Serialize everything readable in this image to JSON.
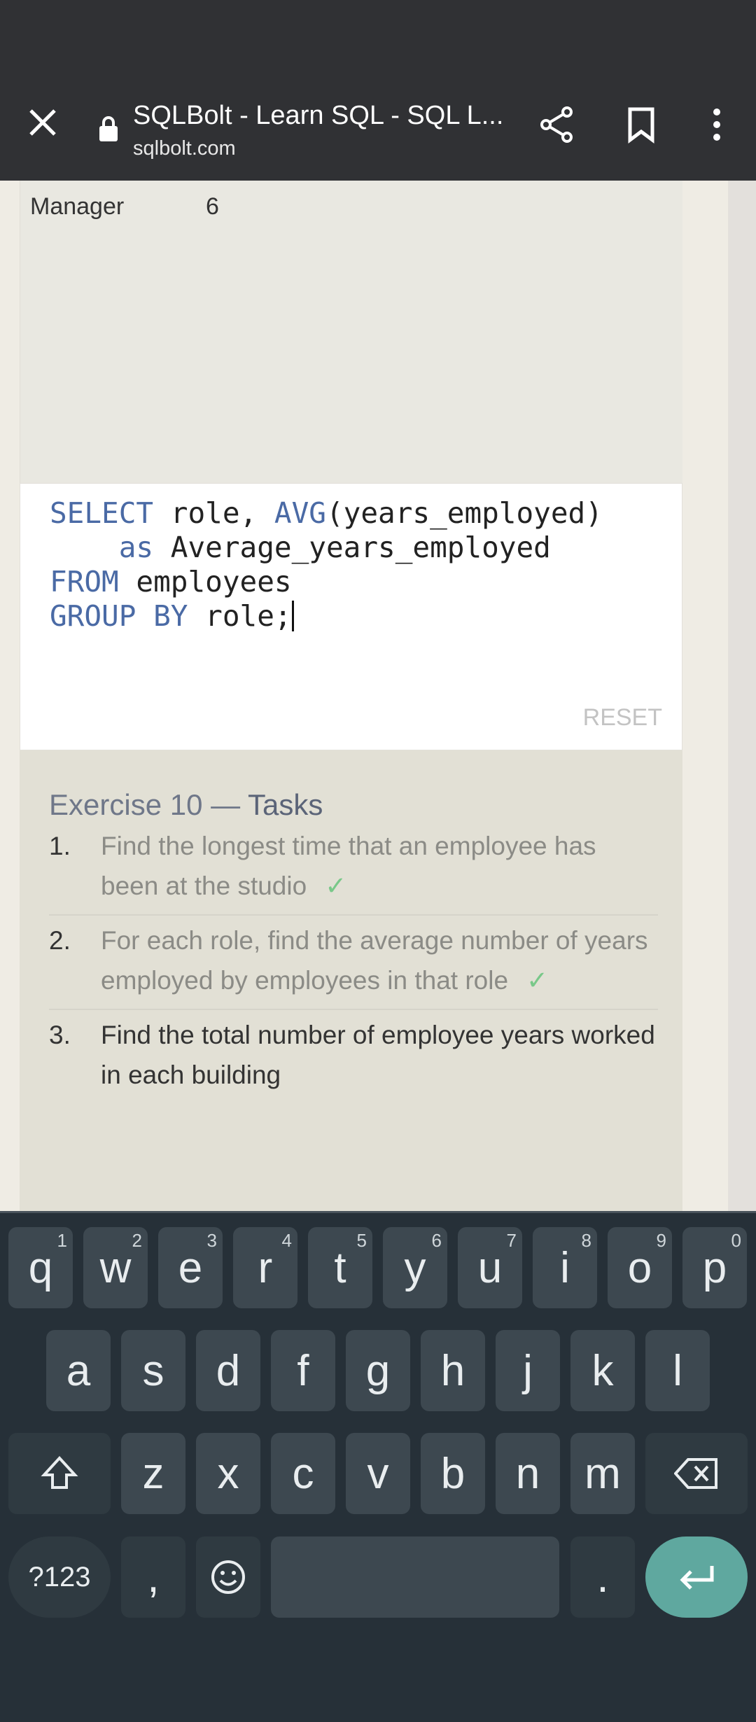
{
  "browser": {
    "title": "SQLBolt - Learn SQL - SQL L...",
    "url": "sqlbolt.com",
    "icons": [
      "close-icon",
      "lock-icon",
      "share-icon",
      "bookmark-icon",
      "more-vert-icon"
    ]
  },
  "results": {
    "row": {
      "role": "Manager",
      "value": "6"
    }
  },
  "editor": {
    "lines": [
      [
        {
          "kw": "SELECT"
        },
        {
          "t": " role, "
        },
        {
          "kw": "AVG"
        },
        {
          "t": "(years_employed)"
        }
      ],
      [
        {
          "t": "    "
        },
        {
          "kw": "as"
        },
        {
          "t": " Average_years_employed"
        }
      ],
      [
        {
          "kw": "FROM"
        },
        {
          "t": " employees"
        }
      ],
      [
        {
          "kw": "GROUP BY"
        },
        {
          "t": " role;"
        }
      ]
    ],
    "reset_label": "RESET",
    "keyword_color": "#4a6aa5"
  },
  "tasks": {
    "heading_a": "Exercise 10 — ",
    "heading_b": "Tasks",
    "check": "✓",
    "check_color": "#79c889",
    "items": [
      {
        "num": "1.",
        "text": "Find the longest time that an employee has been at the studio",
        "done": true
      },
      {
        "num": "2.",
        "text": "For each role, find the average number of years employed by employees in that role",
        "done": true
      },
      {
        "num": "3.",
        "text": "Find the total number of employee years worked in each building",
        "done": false
      }
    ]
  },
  "keyboard": {
    "row1": [
      [
        "q",
        "1"
      ],
      [
        "w",
        "2"
      ],
      [
        "e",
        "3"
      ],
      [
        "r",
        "4"
      ],
      [
        "t",
        "5"
      ],
      [
        "y",
        "6"
      ],
      [
        "u",
        "7"
      ],
      [
        "i",
        "8"
      ],
      [
        "o",
        "9"
      ],
      [
        "p",
        "0"
      ]
    ],
    "row2": [
      "a",
      "s",
      "d",
      "f",
      "g",
      "h",
      "j",
      "k",
      "l"
    ],
    "row3": [
      "z",
      "x",
      "c",
      "v",
      "b",
      "n",
      "m"
    ],
    "symbols_label": "?123",
    "comma": ",",
    "period": ".",
    "icons": [
      "shift-icon",
      "backspace-icon",
      "emoji-icon",
      "enter-icon"
    ],
    "enter_color": "#5fa89f"
  }
}
